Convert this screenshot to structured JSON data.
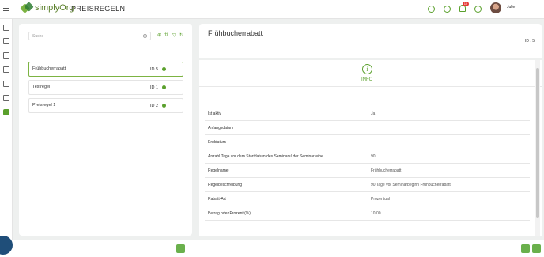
{
  "app": {
    "name": "simplyOrg",
    "page_title": "PREISREGELN"
  },
  "topbar": {
    "notification_count": "10",
    "user_name": "Julie",
    "icons": [
      "lightbulb-icon",
      "info-icon",
      "bell-icon",
      "help-icon"
    ]
  },
  "search": {
    "placeholder": "Suche"
  },
  "toolbar": {
    "icons": [
      "add-icon",
      "sort-icon",
      "filter-icon",
      "refresh-icon"
    ]
  },
  "rules": [
    {
      "name": "Frühbucherrabatt",
      "id": "ID 5",
      "selected": true
    },
    {
      "name": "Testregel",
      "id": "ID 1",
      "selected": false
    },
    {
      "name": "Preisregel 1",
      "id": "ID 2",
      "selected": false
    }
  ],
  "detail": {
    "title": "Frühbucherrabatt",
    "id_label": "ID : 5",
    "section": "INFO",
    "rows": [
      {
        "label": "Ist aktiv",
        "value": "Ja"
      },
      {
        "label": "Anfangsdatum",
        "value": ""
      },
      {
        "label": "Enddatum",
        "value": ""
      },
      {
        "label": "Anzahl Tage vor dem Startdatum des Seminars/ der Seminarreihe",
        "value": "90"
      },
      {
        "label": "Regelname",
        "value": "Frühbucherrabatt"
      },
      {
        "label": "Regelbeschreibung",
        "value": "90 Tage vor Seminarbeginn Frühbucherrabatt"
      },
      {
        "label": "Rabatt-Art",
        "value": "Prozentual"
      },
      {
        "label": "Betrag oder Prozent (%)",
        "value": "10,00"
      }
    ]
  },
  "colors": {
    "accent": "#5aa02c",
    "background": "#eef0ef",
    "badge": "#e53935"
  }
}
